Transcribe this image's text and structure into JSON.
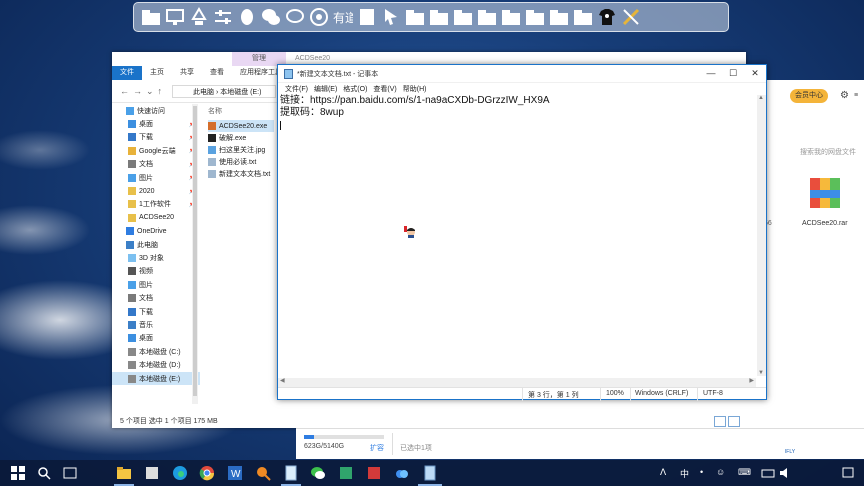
{
  "dock": {
    "icons": [
      "folder-icon",
      "monitor-icon",
      "recycle-icon",
      "sliders-icon",
      "qq-icon",
      "wechat-icon",
      "chat-icon",
      "chrome-icon",
      "text-icon",
      "doc-icon",
      "cursor-icon",
      "folder-icon",
      "folder-icon",
      "folder-icon",
      "folder-icon",
      "folder-icon",
      "folder-icon",
      "folder-icon",
      "folder-icon",
      "shirt-icon",
      "tools-icon"
    ]
  },
  "explorer": {
    "manage_tab": "管理",
    "title": "ACDSee20",
    "ribbon_tabs": [
      "文件",
      "主页",
      "共享",
      "查看",
      "应用程序工具"
    ],
    "breadcrumb": [
      "此电脑",
      "本地磁盘 (E:)"
    ],
    "sidebar": [
      {
        "label": "快速访问",
        "head": true,
        "pin": false
      },
      {
        "label": "桌面",
        "pin": true
      },
      {
        "label": "下载",
        "pin": true
      },
      {
        "label": "Google云端",
        "pin": true
      },
      {
        "label": "文档",
        "pin": true
      },
      {
        "label": "图片",
        "pin": true
      },
      {
        "label": "2020",
        "pin": true
      },
      {
        "label": "1工作软件",
        "pin": true
      },
      {
        "label": "ACDSee20",
        "pin": false
      },
      {
        "label": "OneDrive",
        "head": true,
        "pin": false
      },
      {
        "label": "此电脑",
        "head": true,
        "pin": false
      },
      {
        "label": "3D 对象",
        "pin": false
      },
      {
        "label": "视频",
        "pin": false
      },
      {
        "label": "图片",
        "pin": false
      },
      {
        "label": "文档",
        "pin": false
      },
      {
        "label": "下载",
        "pin": false
      },
      {
        "label": "音乐",
        "pin": false
      },
      {
        "label": "桌面",
        "pin": false
      },
      {
        "label": "本地磁盘 (C:)",
        "pin": false
      },
      {
        "label": "本地磁盘 (D:)",
        "pin": false
      },
      {
        "label": "本地磁盘 (E:)",
        "pin": false,
        "selected": true
      }
    ],
    "files_header": "名称",
    "files": [
      {
        "name": "ACDSee20.exe",
        "selected": true
      },
      {
        "name": "破解.exe",
        "selected": false
      },
      {
        "name": "扫这里关注.jpg",
        "selected": false
      },
      {
        "name": "使用必读.txt",
        "selected": false
      },
      {
        "name": "新建文本文档.txt",
        "selected": false
      }
    ],
    "status": "5 个项目    选中 1 个项目  175 MB"
  },
  "baidu": {
    "vip_label": "会员中心",
    "search_placeholder": "搜索我的网盘文件",
    "rar_label": "ACDSee20.rar",
    "partial_label": "56",
    "disk_usage": "623G/5140G",
    "disk_fill_pct": 12,
    "expand_label": "扩容",
    "selected_label": "已选中1项"
  },
  "notepad": {
    "title": "*新建文本文档.txt - 记事本",
    "menu": [
      "文件(F)",
      "编辑(E)",
      "格式(O)",
      "查看(V)",
      "帮助(H)"
    ],
    "lines": [
      "链接：https://pan.baidu.com/s/1-na9aCXDb-DGrzzIW_HX9A",
      "提取码：8wup"
    ],
    "status_position": "第 3 行，第 1 列",
    "status_zoom": "100%",
    "status_eol": "Windows (CRLF)",
    "status_encoding": "UTF-8"
  },
  "taskbar": {
    "ime_label": "中",
    "ime_badge": "IFLY",
    "tray_symbols": [
      "ᐱ",
      "中",
      "•",
      "☺",
      "⌨"
    ]
  },
  "colors": {
    "accent": "#1a73c9",
    "vip": "#f4b43a",
    "selection": "#cce4f7"
  }
}
